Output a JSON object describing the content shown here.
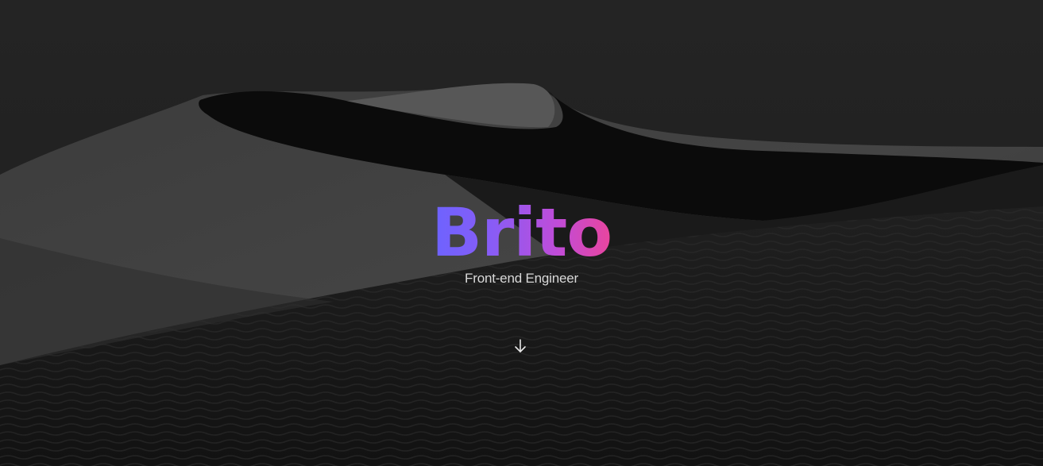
{
  "hero": {
    "title": "Brito",
    "subtitle": "Front-end Engineer",
    "scroll_icon": "arrow-down-icon"
  },
  "colors": {
    "gradient_start": "#6c63ff",
    "gradient_mid": "#c04cd8",
    "gradient_end": "#e9459d",
    "subtitle": "#d9d9d9",
    "background": "#1c1c1c"
  }
}
